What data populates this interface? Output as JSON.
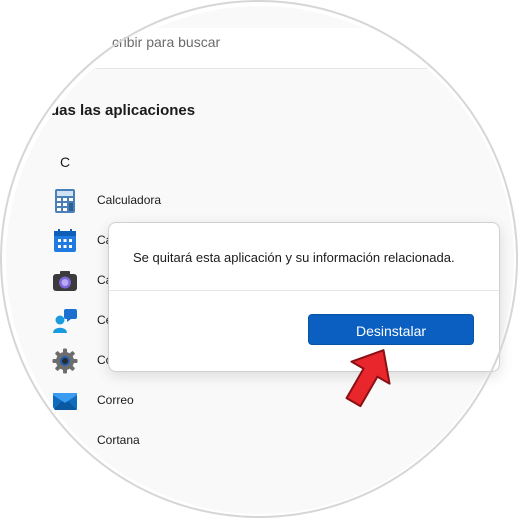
{
  "search": {
    "placeholder_text": "cribir para buscar"
  },
  "section": {
    "title": "das las aplicaciones"
  },
  "group_letter": "C",
  "apps": [
    {
      "label": "Calculadora",
      "icon": "calculator-icon"
    },
    {
      "label": "Cal",
      "icon": "calendar-icon"
    },
    {
      "label": "Cár",
      "icon": "camera-icon"
    },
    {
      "label": "Cer",
      "icon": "feedback-hub-icon"
    },
    {
      "label": "Cor",
      "icon": "settings-gear-icon"
    },
    {
      "label": "Correo",
      "icon": "mail-icon"
    },
    {
      "label": "Cortana",
      "icon": "cortana-icon"
    }
  ],
  "dialog": {
    "message": "Se quitará esta aplicación y su información relacionada.",
    "uninstall_label": "Desinstalar"
  },
  "colors": {
    "accent": "#0a5fc1",
    "pointer_arrow": "#e8262c"
  }
}
